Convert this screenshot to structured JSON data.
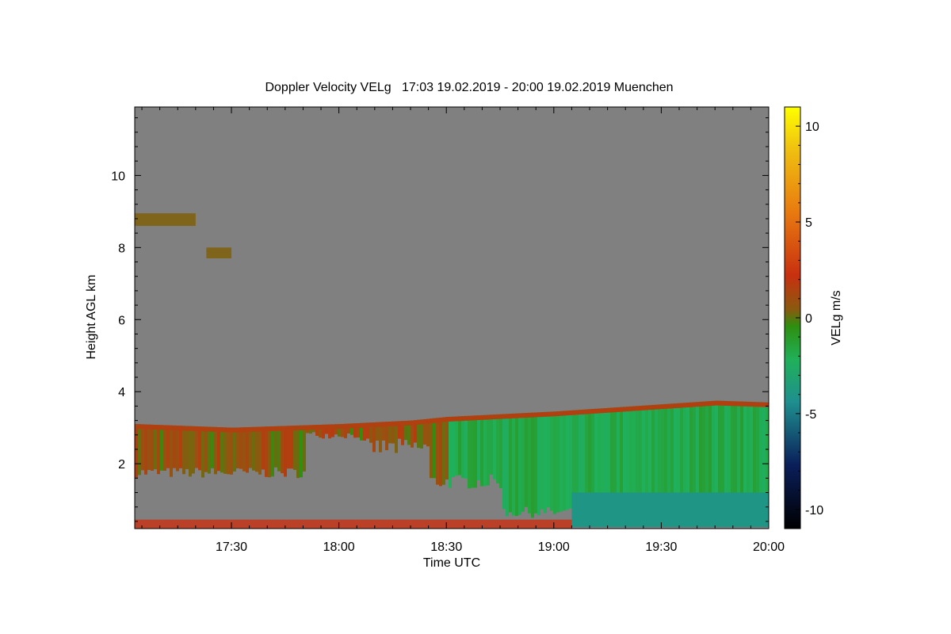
{
  "chart_data": {
    "type": "heatmap",
    "title": "Doppler Velocity VELg   17:03 19.02.2019 - 20:00 19.02.2019 Muenchen",
    "xlabel": "Time UTC",
    "ylabel": "Height AGL km",
    "colorbar_label": "VELg m/s",
    "x_range": [
      "17:03",
      "20:00"
    ],
    "x_ticks": [
      "17:30",
      "18:00",
      "18:30",
      "19:00",
      "19:30",
      "20:00"
    ],
    "ylim": [
      0.2,
      11.9
    ],
    "y_ticks": [
      2,
      4,
      6,
      8,
      10
    ],
    "color_range": [
      -11,
      11
    ],
    "colorbar_ticks": [
      -10,
      -5,
      0,
      5,
      10
    ],
    "background_color": "#808080",
    "cloud_top_km": [
      {
        "time": "17:03",
        "height": 3.1
      },
      {
        "time": "17:30",
        "height": 3.0
      },
      {
        "time": "18:00",
        "height": 3.1
      },
      {
        "time": "18:20",
        "height": 3.2
      },
      {
        "time": "18:30",
        "height": 3.3
      },
      {
        "time": "19:00",
        "height": 3.45
      },
      {
        "time": "19:30",
        "height": 3.65
      },
      {
        "time": "19:45",
        "height": 3.75
      },
      {
        "time": "20:00",
        "height": 3.7
      }
    ],
    "low_layer": {
      "start": "19:05",
      "end": "20:00",
      "top_km": 1.2,
      "velocity": -4
    }
  }
}
